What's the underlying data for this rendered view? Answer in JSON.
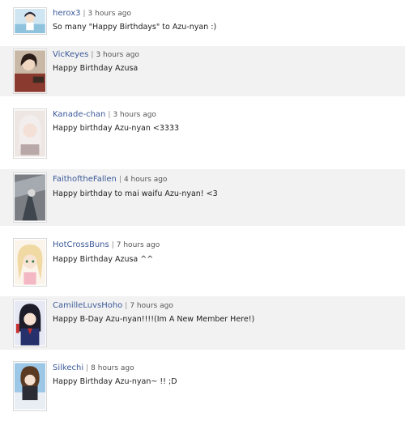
{
  "comments": [
    {
      "username": "herox3",
      "time": "3 hours ago",
      "text": "So many \"Happy Birthdays\" to Azu-nyan :)"
    },
    {
      "username": "VicKeyes",
      "time": "3 hours ago",
      "text": "Happy Birthday Azusa"
    },
    {
      "username": "Kanade-chan",
      "time": "3 hours ago",
      "text": "Happy birthday Azu-nyan <3333"
    },
    {
      "username": "FaithoftheFallen",
      "time": "4 hours ago",
      "text": "Happy birthday to mai waifu Azu-nyan! <3"
    },
    {
      "username": "HotCrossBuns",
      "time": "7 hours ago",
      "text": "Happy Birthday Azusa ^^"
    },
    {
      "username": "CamilleLuvsHoho",
      "time": "7 hours ago",
      "text": "Happy B-Day Azu-nyan!!!!(Im A New Member Here!)"
    },
    {
      "username": "Silkechi",
      "time": "8 hours ago",
      "text": "Happy Birthday Azu-nyan~ !! ;D"
    }
  ],
  "separator": "|"
}
